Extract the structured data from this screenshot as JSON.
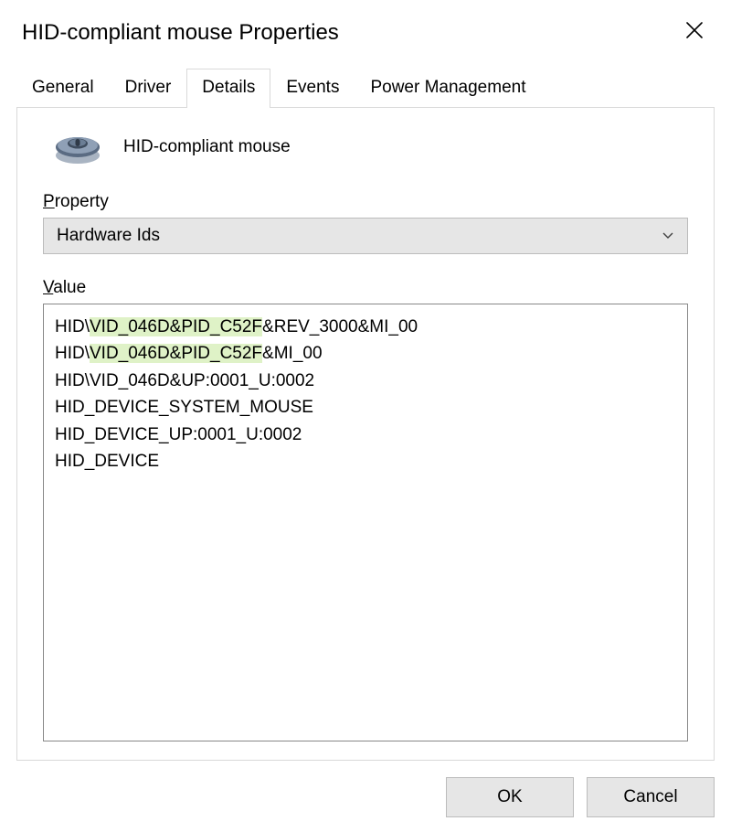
{
  "dialog": {
    "title": "HID-compliant mouse Properties"
  },
  "tabs": [
    {
      "label": "General"
    },
    {
      "label": "Driver"
    },
    {
      "label": "Details",
      "active": true
    },
    {
      "label": "Events"
    },
    {
      "label": "Power Management"
    }
  ],
  "details": {
    "device_name": "HID-compliant mouse",
    "property_label_prefix": "P",
    "property_label_rest": "roperty",
    "property_dropdown_value": "Hardware Ids",
    "value_label_prefix": "V",
    "value_label_rest": "alue",
    "value_rows": [
      {
        "pre": "HID\\",
        "hl": "VID_046D&PID_C52F",
        "post": "&REV_3000&MI_00"
      },
      {
        "pre": "HID\\",
        "hl": "VID_046D&PID_C52F",
        "post": "&MI_00"
      },
      {
        "pre": "HID\\VID_046D&UP:0001_U:0002",
        "hl": "",
        "post": ""
      },
      {
        "pre": "HID_DEVICE_SYSTEM_MOUSE",
        "hl": "",
        "post": ""
      },
      {
        "pre": "HID_DEVICE_UP:0001_U:0002",
        "hl": "",
        "post": ""
      },
      {
        "pre": "HID_DEVICE",
        "hl": "",
        "post": ""
      }
    ]
  },
  "buttons": {
    "ok": "OK",
    "cancel": "Cancel"
  },
  "icons": {
    "close": "close-icon",
    "chevron_down": "chevron-down-icon",
    "mouse": "mouse-icon"
  }
}
